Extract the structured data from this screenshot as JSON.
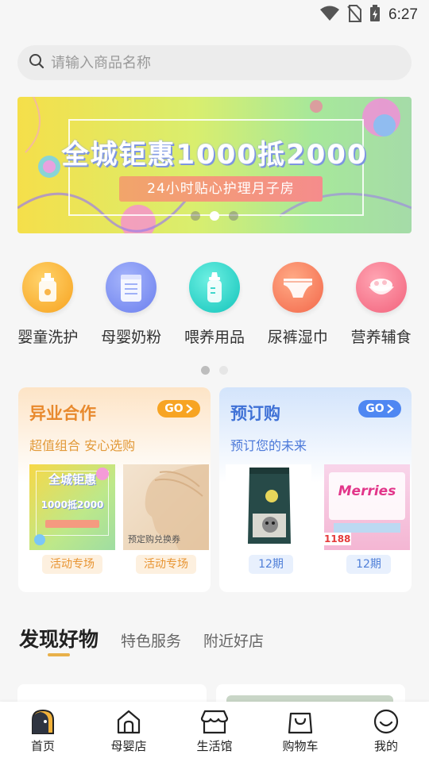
{
  "status_bar": {
    "time": "6:27",
    "icons": [
      "wifi-icon",
      "no-sim-icon",
      "battery-charging-icon"
    ]
  },
  "search": {
    "placeholder": "请输入商品名称",
    "icon": "search-icon"
  },
  "banner": {
    "title": "全城钜惠1000抵2000",
    "subtitle": "24小时贴心护理月子房",
    "page_count": 3,
    "active_index": 1
  },
  "categories": {
    "items": [
      {
        "label": "婴童洗护",
        "icon": "lotion-bottle-icon",
        "color": "#f9a623"
      },
      {
        "label": "母婴奶粉",
        "icon": "milk-powder-can-icon",
        "color": "#7d8cf2"
      },
      {
        "label": "喂养用品",
        "icon": "baby-bottle-icon",
        "color": "#1fd1c6"
      },
      {
        "label": "尿裤湿巾",
        "icon": "diaper-icon",
        "color": "#f57a57"
      },
      {
        "label": "营养辅食",
        "icon": "food-bowl-icon",
        "color": "#f7728a"
      }
    ],
    "page_count": 2,
    "active_index": 0
  },
  "cards": {
    "left": {
      "title": "异业合作",
      "subtitle": "超值组合 安心选购",
      "go_label": "GO",
      "items": [
        {
          "tag": "活动专场",
          "image_text": "全城钜惠",
          "image_text2": "1000抵2000"
        },
        {
          "tag": "活动专场",
          "image_text": "预定购兑换券"
        }
      ]
    },
    "right": {
      "title": "预订购",
      "subtitle": "预订您的未来",
      "go_label": "GO",
      "items": [
        {
          "tag": "12期"
        },
        {
          "tag": "12期",
          "brand": "Merries",
          "price": "1188"
        }
      ]
    }
  },
  "discover": {
    "tabs": [
      "发现好物",
      "特色服务",
      "附近好店"
    ],
    "active_index": 0
  },
  "bottom_nav": {
    "items": [
      {
        "label": "首页",
        "icon": "home-active-icon"
      },
      {
        "label": "母婴店",
        "icon": "house-icon"
      },
      {
        "label": "生活馆",
        "icon": "store-icon"
      },
      {
        "label": "购物车",
        "icon": "shopping-bag-icon"
      },
      {
        "label": "我的",
        "icon": "smile-face-icon"
      }
    ],
    "active_index": 0
  },
  "colors": {
    "accent_orange": "#f7a423",
    "accent_blue": "#4f87f2",
    "tab_underline": "#e8b04a"
  }
}
